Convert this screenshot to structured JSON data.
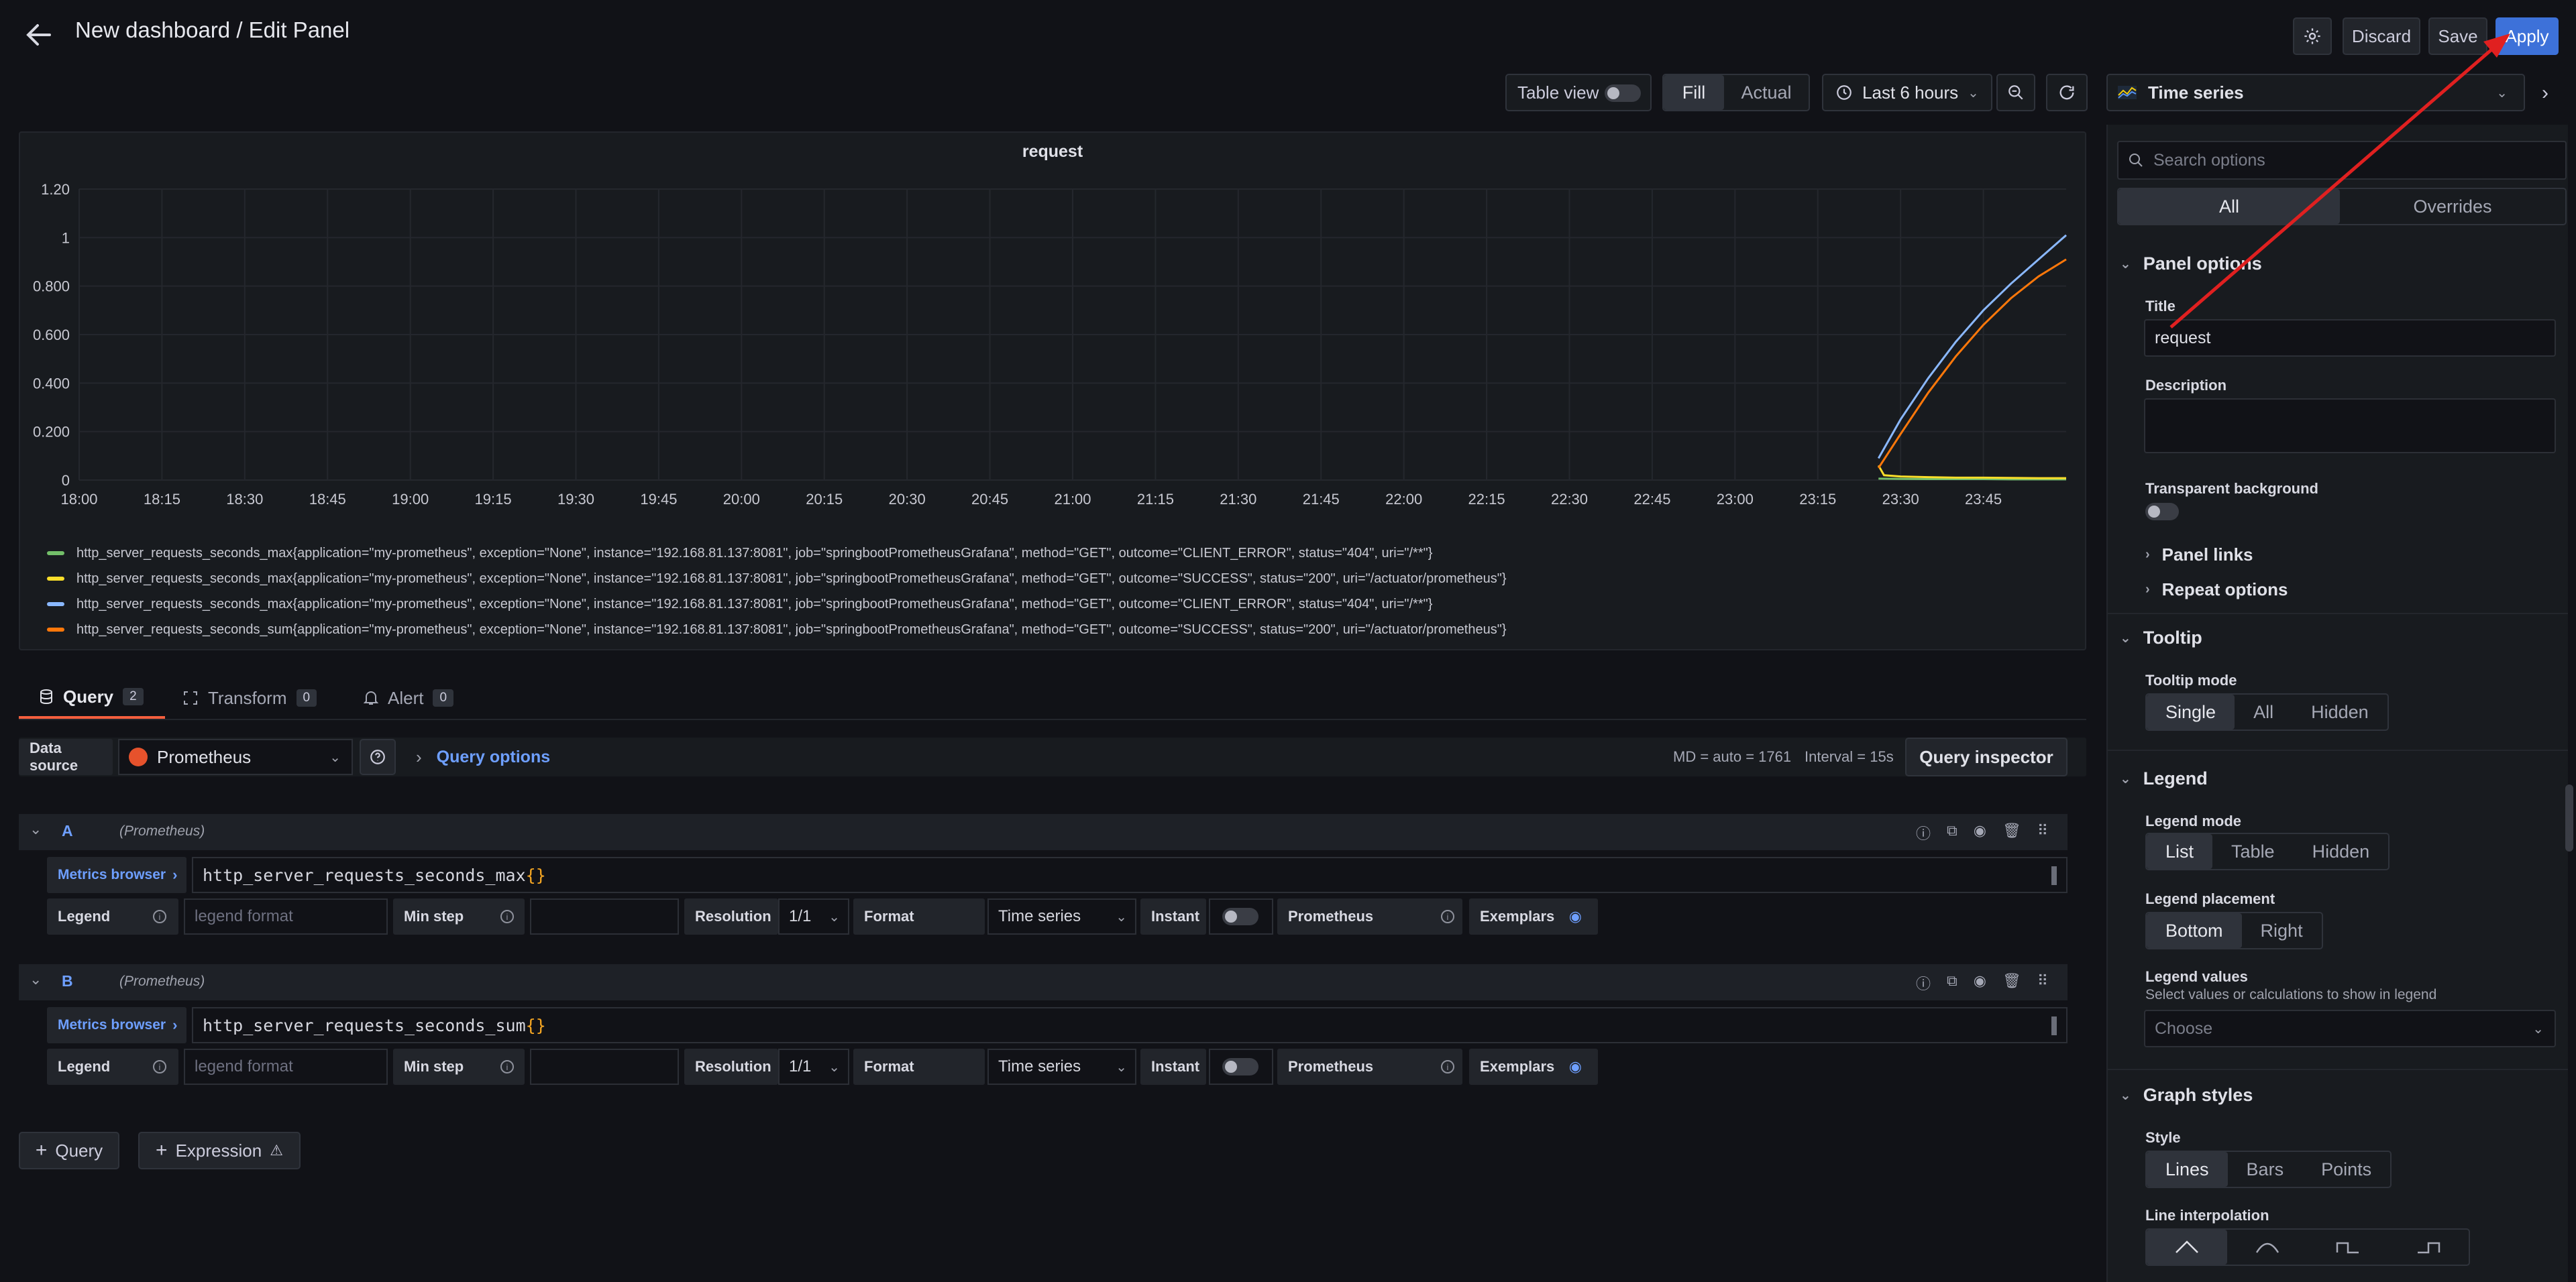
{
  "header": {
    "title": "New dashboard / Edit Panel",
    "discard_label": "Discard",
    "save_label": "Save",
    "apply_label": "Apply"
  },
  "toolbar": {
    "table_view_label": "Table view",
    "fill_label": "Fill",
    "actual_label": "Actual",
    "time_range_label": "Last 6 hours"
  },
  "viz_picker": {
    "selected": "Time series"
  },
  "chart_data": {
    "type": "line",
    "title": "request",
    "y_ticks": [
      "1.20",
      "1",
      "0.800",
      "0.600",
      "0.400",
      "0.200",
      "0"
    ],
    "ylim": [
      0,
      1.2
    ],
    "x_ticks": [
      "18:00",
      "18:15",
      "18:30",
      "18:45",
      "19:00",
      "19:15",
      "19:30",
      "19:45",
      "20:00",
      "20:15",
      "20:30",
      "20:45",
      "21:00",
      "21:15",
      "21:30",
      "21:45",
      "22:00",
      "22:15",
      "22:30",
      "22:45",
      "23:00",
      "23:15",
      "23:30",
      "23:45"
    ],
    "x_start_min": 1080,
    "x_end_min": 1440,
    "grid": true,
    "legend_placement": "bottom",
    "series": [
      {
        "name": "http_server_requests_seconds_max{application=\"my-prometheus\", exception=\"None\", instance=\"192.168.81.137:8081\", job=\"springbootPrometheusGrafana\", method=\"GET\", outcome=\"CLIENT_ERROR\", status=\"404\", uri=\"/**\"}",
        "color": "#73bf69",
        "x_min": [
          1406,
          1410,
          1415,
          1420,
          1425,
          1430,
          1435,
          1440
        ],
        "values": [
          0.006,
          0.005,
          0.004,
          0.004,
          0.004,
          0.003,
          0.003,
          0.003
        ]
      },
      {
        "name": "http_server_requests_seconds_max{application=\"my-prometheus\", exception=\"None\", instance=\"192.168.81.137:8081\", job=\"springbootPrometheusGrafana\", method=\"GET\", outcome=\"SUCCESS\", status=\"200\", uri=\"/actuator/prometheus\"}",
        "color": "#fade2a",
        "x_min": [
          1406,
          1407,
          1410,
          1415,
          1420,
          1425,
          1430,
          1435,
          1440
        ],
        "values": [
          0.06,
          0.02,
          0.015,
          0.012,
          0.01,
          0.01,
          0.009,
          0.008,
          0.008
        ]
      },
      {
        "name": "http_server_requests_seconds_max{application=\"my-prometheus\", exception=\"None\", instance=\"192.168.81.137:8081\", job=\"springbootPrometheusGrafana\", method=\"GET\", outcome=\"CLIENT_ERROR\", status=\"404\", uri=\"/**\"}",
        "color": "#8ab8ff",
        "x_min": [
          1406,
          1410,
          1415,
          1420,
          1425,
          1430,
          1435,
          1440
        ],
        "values": [
          0.09,
          0.25,
          0.42,
          0.57,
          0.7,
          0.81,
          0.91,
          1.01
        ]
      },
      {
        "name": "http_server_requests_seconds_sum{application=\"my-prometheus\", exception=\"None\", instance=\"192.168.81.137:8081\", job=\"springbootPrometheusGrafana\", method=\"GET\", outcome=\"SUCCESS\", status=\"200\", uri=\"/actuator/prometheus\"}",
        "color": "#ff780a",
        "x_min": [
          1406,
          1410,
          1415,
          1420,
          1425,
          1430,
          1435,
          1440
        ],
        "values": [
          0.05,
          0.19,
          0.36,
          0.51,
          0.64,
          0.75,
          0.84,
          0.91
        ]
      }
    ]
  },
  "tabs": [
    {
      "label": "Query",
      "count": "2"
    },
    {
      "label": "Transform",
      "count": "0"
    },
    {
      "label": "Alert",
      "count": "0"
    }
  ],
  "datasource": {
    "label": "Data source",
    "name": "Prometheus",
    "query_options": "Query options",
    "md_text": "MD = auto = 1761",
    "interval_text": "Interval = 15s",
    "inspector_label": "Query inspector"
  },
  "queries": [
    {
      "letter": "A",
      "source": "(Prometheus)",
      "metric": "http_server_requests_seconds_max",
      "braces": "{}"
    },
    {
      "letter": "B",
      "source": "(Prometheus)",
      "metric": "http_server_requests_seconds_sum",
      "braces": "{}"
    }
  ],
  "query_row": {
    "metrics_browser": "Metrics browser",
    "legend": "Legend",
    "legend_placeholder": "legend format",
    "min_step": "Min step",
    "resolution": "Resolution",
    "resolution_value": "1/1",
    "format": "Format",
    "format_value": "Time series",
    "instant": "Instant",
    "type": "Prometheus",
    "exemplars": "Exemplars"
  },
  "add_query_label": "Query",
  "add_expression_label": "Expression",
  "options": {
    "search_placeholder": "Search options",
    "all_label": "All",
    "overrides_label": "Overrides",
    "panel_options": "Panel options",
    "title_label": "Title",
    "title_value": "request",
    "description_label": "Description",
    "transparent_label": "Transparent background",
    "panel_links": "Panel links",
    "repeat_options": "Repeat options",
    "tooltip": "Tooltip",
    "tooltip_mode": "Tooltip mode",
    "tooltip_single": "Single",
    "tooltip_all": "All",
    "tooltip_hidden": "Hidden",
    "legend": "Legend",
    "legend_mode": "Legend mode",
    "legend_list": "List",
    "legend_table": "Table",
    "legend_hidden": "Hidden",
    "legend_placement": "Legend placement",
    "placement_bottom": "Bottom",
    "placement_right": "Right",
    "legend_values": "Legend values",
    "legend_values_hint": "Select values or calculations to show in legend",
    "choose_placeholder": "Choose",
    "graph_styles": "Graph styles",
    "style_label": "Style",
    "style_lines": "Lines",
    "style_bars": "Bars",
    "style_points": "Points",
    "line_interpolation": "Line interpolation"
  },
  "colors": {
    "accent": "#3d71d9",
    "annotation": "#e02020",
    "query_tab_underline": "#f55f3e"
  }
}
